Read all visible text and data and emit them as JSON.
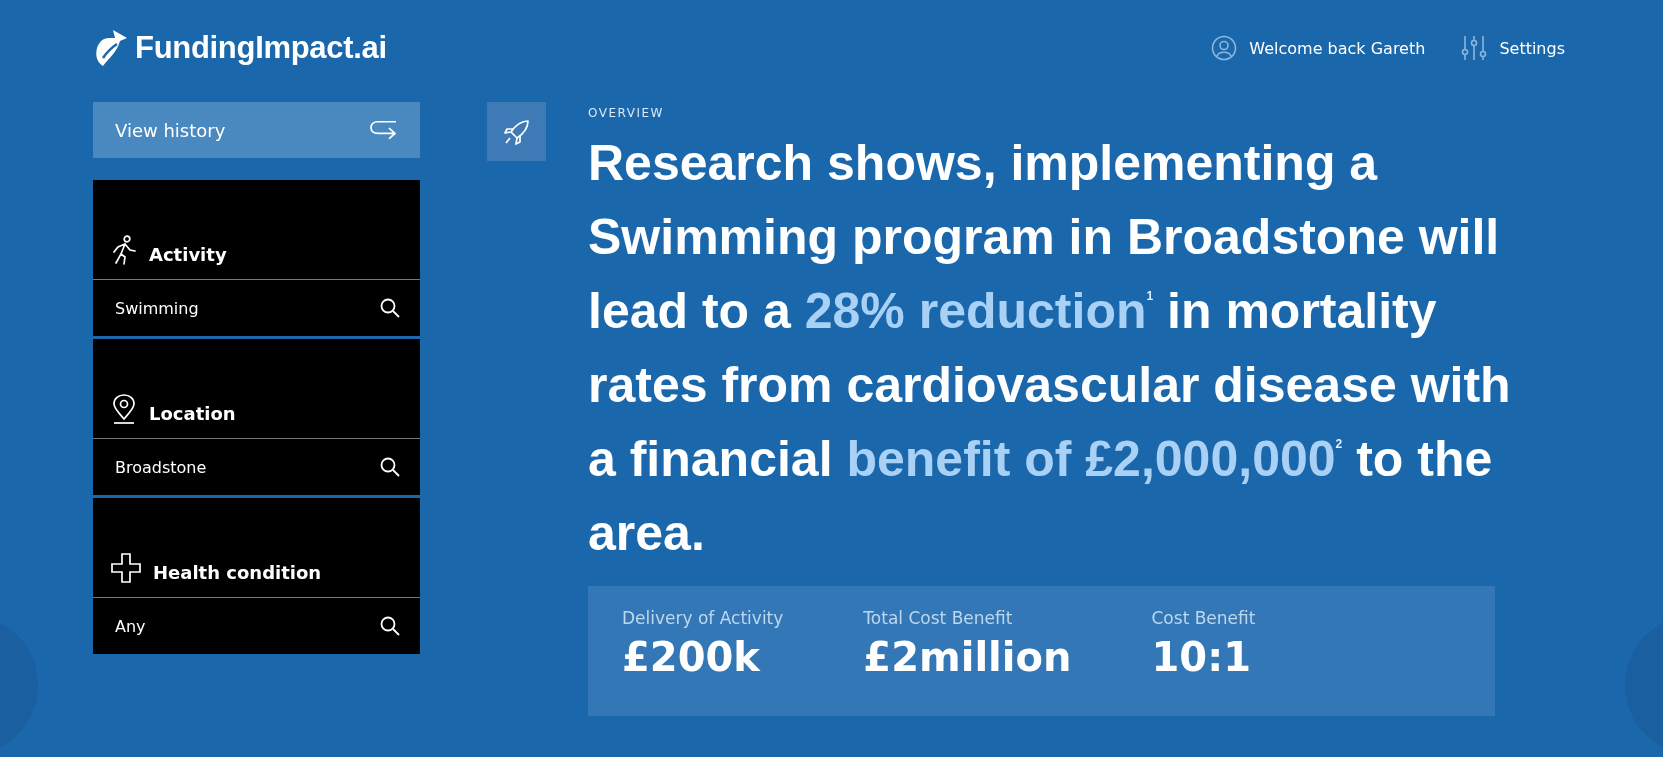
{
  "header": {
    "brand": "FundingImpact.ai",
    "user": "Welcome back Gareth",
    "settings": "Settings"
  },
  "history_button": "View history",
  "filters": [
    {
      "kind": "activity",
      "label": "Activity",
      "value": "Swimming"
    },
    {
      "kind": "location",
      "label": "Location",
      "value": "Broadstone"
    },
    {
      "kind": "health",
      "label": "Health condition",
      "value": "Any"
    }
  ],
  "overview": {
    "eyebrow": "OVERVIEW",
    "headline": [
      {
        "text": "Research shows, implementing a Swimming program in Broadstone will lead to a ",
        "highlight": false
      },
      {
        "text": "28% reduction$^{1}$",
        "highlight": true
      },
      {
        "text": " in mortality rates from cardiovascular disease with a financial ",
        "highlight": false
      },
      {
        "text": "benefit of £2,000,000$^{2}$",
        "highlight": true
      },
      {
        "text": " to the area.",
        "highlight": false
      }
    ]
  },
  "stats": [
    {
      "label": "Delivery of Activity",
      "value": "£200k"
    },
    {
      "label": "Total Cost Benefit",
      "value": "£2million"
    },
    {
      "label": "Cost Benefit",
      "value": "10:1"
    }
  ]
}
